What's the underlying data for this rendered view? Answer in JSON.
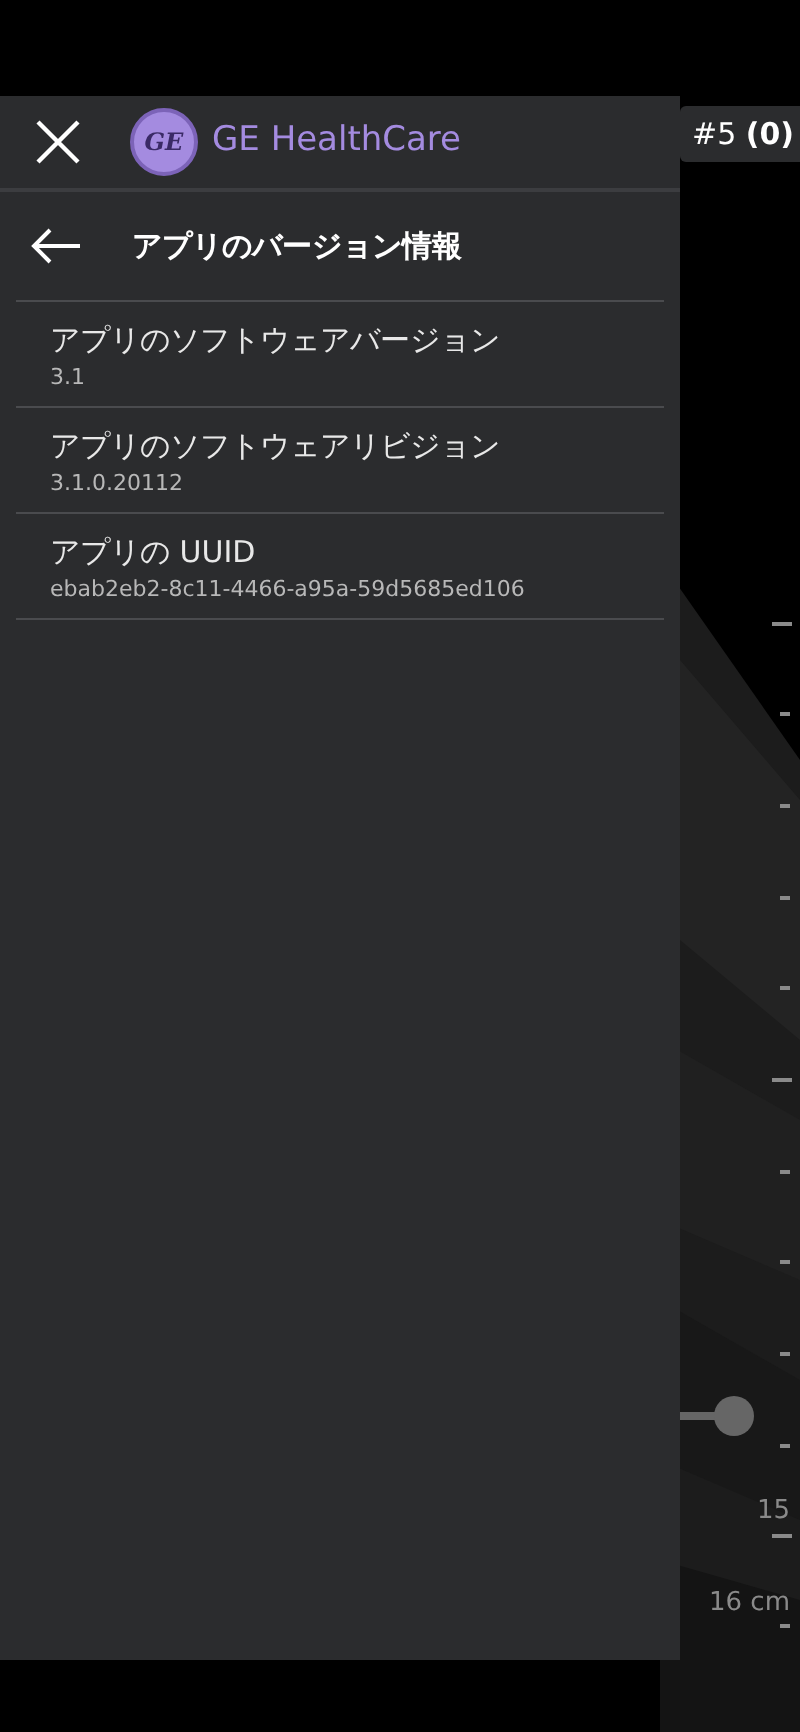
{
  "header": {
    "brand": "GE HealthCare",
    "logo_text": "GE"
  },
  "page": {
    "title": "アプリのバージョン情報"
  },
  "items": [
    {
      "label": "アプリのソフトウェアバージョン",
      "value": "3.1"
    },
    {
      "label": "アプリのソフトウェアリビジョン",
      "value": "3.1.0.20112"
    },
    {
      "label": "アプリの UUID",
      "value": "ebab2eb2-8c11-4466-a95a-59d5685ed106"
    }
  ],
  "image_view": {
    "clip_badge": "#5 **(0)**",
    "depth_labels": [
      "15",
      "16 cm"
    ]
  }
}
